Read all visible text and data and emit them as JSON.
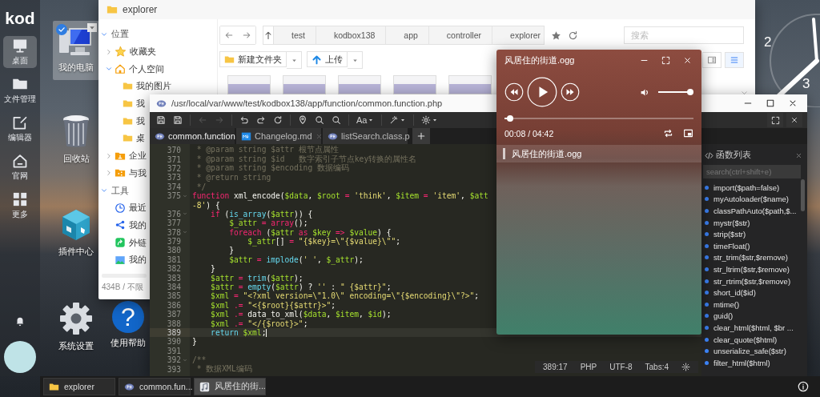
{
  "dock": {
    "logo": "kod",
    "items": [
      {
        "kind": "desktop",
        "label": "桌面",
        "selected": true
      },
      {
        "kind": "files",
        "label": "文件管理",
        "selected": false
      },
      {
        "kind": "editor",
        "label": "编辑器",
        "selected": false
      },
      {
        "kind": "home",
        "label": "官网",
        "selected": false
      },
      {
        "kind": "apps",
        "label": "更多",
        "selected": false
      }
    ]
  },
  "desktop_icons": [
    {
      "kind": "computer",
      "label": "我的电脑",
      "selected": true
    },
    {
      "kind": "trash",
      "label": "回收站",
      "selected": false
    },
    {
      "kind": "plugin",
      "label": "插件中心",
      "selected": false
    },
    {
      "kind": "settings",
      "label": "系统设置",
      "selected": false
    },
    {
      "kind": "help",
      "label": "使用帮助",
      "selected": false,
      "glyph": "?"
    }
  ],
  "clock": {
    "numerals": [
      "2",
      "3"
    ]
  },
  "explorer": {
    "title": "explorer",
    "tree": [
      {
        "kind": "section",
        "label": "位置",
        "expanded": true,
        "children": [
          {
            "kind": "star",
            "label": "收藏夹",
            "expanded": false
          },
          {
            "kind": "home",
            "label": "个人空间",
            "expanded": true,
            "children": [
              {
                "kind": "folder",
                "label": "我的图片"
              },
              {
                "kind": "folder",
                "label": "我"
              },
              {
                "kind": "folder",
                "label": "我"
              },
              {
                "kind": "folder",
                "label": "桌"
              }
            ]
          },
          {
            "kind": "org",
            "label": "企业",
            "expanded": false
          },
          {
            "kind": "share",
            "label": "与我",
            "expanded": false
          }
        ]
      },
      {
        "kind": "section",
        "label": "工具",
        "expanded": true,
        "children": [
          {
            "kind": "recent",
            "label": "最近"
          },
          {
            "kind": "link",
            "label": "我的"
          },
          {
            "kind": "outlink",
            "label": "外链"
          },
          {
            "kind": "photo",
            "label": "我的"
          }
        ]
      }
    ],
    "footer": {
      "usage": "434B / 不限"
    },
    "breadcrumb": [
      "test",
      "kodbox138",
      "app",
      "controller",
      "explorer"
    ],
    "search": {
      "placeholder": "搜索"
    },
    "toolbar": [
      "新建文件夹",
      "上传"
    ]
  },
  "editor": {
    "path": "/usr/local/var/www/test/kodbox138/app/function/common.function.php",
    "font_label": "Aa",
    "tabs": [
      {
        "kind": "php",
        "label": "common.function",
        "selected": true
      },
      {
        "kind": "md",
        "label": "Changelog.md",
        "selected": false
      },
      {
        "kind": "php",
        "label": "listSearch.class.p",
        "selected": false
      }
    ],
    "lines": [
      {
        "num": "370",
        "fold": false,
        "active": false,
        "tokens": [
          {
            "kind": "comment",
            "text": " * @param string $attr 根节点属性"
          }
        ]
      },
      {
        "num": "371",
        "fold": false,
        "active": false,
        "tokens": [
          {
            "kind": "comment",
            "text": " * @param string $id   数字索引子节点key转换的属性名"
          }
        ]
      },
      {
        "num": "372",
        "fold": false,
        "active": false,
        "tokens": [
          {
            "kind": "comment",
            "text": " * @param string $encoding 数据编码"
          }
        ]
      },
      {
        "num": "373",
        "fold": false,
        "active": false,
        "tokens": [
          {
            "kind": "comment",
            "text": " * @return string"
          }
        ]
      },
      {
        "num": "374",
        "fold": false,
        "active": false,
        "tokens": [
          {
            "kind": "comment",
            "text": " */"
          }
        ]
      },
      {
        "num": "375",
        "fold": true,
        "active": false,
        "tokens": [
          {
            "kind": "keyword",
            "text": "function"
          },
          {
            "kind": "plain",
            "text": " xml_encode("
          },
          {
            "kind": "variable",
            "text": "$data"
          },
          {
            "kind": "plain",
            "text": ", "
          },
          {
            "kind": "variable",
            "text": "$root"
          },
          {
            "kind": "keyword",
            "text": " = "
          },
          {
            "kind": "string",
            "text": "'think'"
          },
          {
            "kind": "plain",
            "text": ", "
          },
          {
            "kind": "variable",
            "text": "$item"
          },
          {
            "kind": "keyword",
            "text": " = "
          },
          {
            "kind": "string",
            "text": "'item'"
          },
          {
            "kind": "plain",
            "text": ", "
          },
          {
            "kind": "variable",
            "text": "$att"
          }
        ]
      },
      {
        "fold": false,
        "active": false,
        "tokens": [
          {
            "kind": "string",
            "text": "-8'"
          },
          {
            "kind": "plain",
            "text": ") {"
          }
        ]
      },
      {
        "num": "376",
        "fold": true,
        "active": false,
        "tokens": [
          {
            "kind": "keyword",
            "text": "    if"
          },
          {
            "kind": "plain",
            "text": " ("
          },
          {
            "kind": "function",
            "text": "is_array"
          },
          {
            "kind": "plain",
            "text": "("
          },
          {
            "kind": "variable",
            "text": "$attr"
          },
          {
            "kind": "plain",
            "text": ")) {"
          }
        ]
      },
      {
        "num": "377",
        "fold": false,
        "active": false,
        "tokens": [
          {
            "kind": "variable",
            "text": "        $_attr"
          },
          {
            "kind": "keyword",
            "text": " = "
          },
          {
            "kind": "keyword",
            "text": "array"
          },
          {
            "kind": "plain",
            "text": "();"
          }
        ]
      },
      {
        "num": "378",
        "fold": true,
        "active": false,
        "tokens": [
          {
            "kind": "keyword",
            "text": "        foreach"
          },
          {
            "kind": "plain",
            "text": " ("
          },
          {
            "kind": "variable",
            "text": "$attr"
          },
          {
            "kind": "keyword",
            "text": " as "
          },
          {
            "kind": "variable",
            "text": "$key"
          },
          {
            "kind": "keyword",
            "text": " => "
          },
          {
            "kind": "variable",
            "text": "$value"
          },
          {
            "kind": "plain",
            "text": ") {"
          }
        ]
      },
      {
        "num": "379",
        "fold": false,
        "active": false,
        "tokens": [
          {
            "kind": "variable",
            "text": "            $_attr"
          },
          {
            "kind": "plain",
            "text": "[]"
          },
          {
            "kind": "keyword",
            "text": " = "
          },
          {
            "kind": "string",
            "text": "\"{$key}=\\\"{$value}\\\"\""
          },
          {
            "kind": "plain",
            "text": ";"
          }
        ]
      },
      {
        "num": "380",
        "fold": false,
        "active": false,
        "tokens": [
          {
            "kind": "plain",
            "text": "        }"
          }
        ]
      },
      {
        "num": "381",
        "fold": false,
        "active": false,
        "tokens": [
          {
            "kind": "variable",
            "text": "        $attr"
          },
          {
            "kind": "keyword",
            "text": " = "
          },
          {
            "kind": "function",
            "text": "implode"
          },
          {
            "kind": "plain",
            "text": "("
          },
          {
            "kind": "string",
            "text": "' '"
          },
          {
            "kind": "plain",
            "text": ", "
          },
          {
            "kind": "variable",
            "text": "$_attr"
          },
          {
            "kind": "plain",
            "text": ");"
          }
        ]
      },
      {
        "num": "382",
        "fold": false,
        "active": false,
        "tokens": [
          {
            "kind": "plain",
            "text": "    }"
          }
        ]
      },
      {
        "num": "383",
        "fold": false,
        "active": false,
        "tokens": [
          {
            "kind": "variable",
            "text": "    $attr"
          },
          {
            "kind": "keyword",
            "text": " = "
          },
          {
            "kind": "function",
            "text": "trim"
          },
          {
            "kind": "plain",
            "text": "("
          },
          {
            "kind": "variable",
            "text": "$attr"
          },
          {
            "kind": "plain",
            "text": ");"
          }
        ]
      },
      {
        "num": "384",
        "fold": false,
        "active": false,
        "tokens": [
          {
            "kind": "variable",
            "text": "    $attr"
          },
          {
            "kind": "keyword",
            "text": " = "
          },
          {
            "kind": "function",
            "text": "empty"
          },
          {
            "kind": "plain",
            "text": "("
          },
          {
            "kind": "variable",
            "text": "$attr"
          },
          {
            "kind": "plain",
            "text": ") ? "
          },
          {
            "kind": "string",
            "text": "''"
          },
          {
            "kind": "plain",
            "text": " : "
          },
          {
            "kind": "string",
            "text": "\" {$attr}\""
          },
          {
            "kind": "plain",
            "text": ";"
          }
        ]
      },
      {
        "num": "385",
        "fold": false,
        "active": false,
        "tokens": [
          {
            "kind": "variable",
            "text": "    $xml"
          },
          {
            "kind": "keyword",
            "text": " = "
          },
          {
            "kind": "string",
            "text": "\"<?xml version=\\\"1.0\\\" encoding=\\\"{$encoding}\\\"?>\""
          },
          {
            "kind": "plain",
            "text": ";"
          }
        ]
      },
      {
        "num": "386",
        "fold": false,
        "active": false,
        "tokens": [
          {
            "kind": "variable",
            "text": "    $xml"
          },
          {
            "kind": "keyword",
            "text": " .= "
          },
          {
            "kind": "string",
            "text": "\"<{$root}{$attr}>\""
          },
          {
            "kind": "plain",
            "text": ";"
          }
        ]
      },
      {
        "num": "387",
        "fold": false,
        "active": false,
        "tokens": [
          {
            "kind": "variable",
            "text": "    $xml"
          },
          {
            "kind": "keyword",
            "text": " .= "
          },
          {
            "kind": "plain",
            "text": "data_to_xml("
          },
          {
            "kind": "variable",
            "text": "$data"
          },
          {
            "kind": "plain",
            "text": ", "
          },
          {
            "kind": "variable",
            "text": "$item"
          },
          {
            "kind": "plain",
            "text": ", "
          },
          {
            "kind": "variable",
            "text": "$id"
          },
          {
            "kind": "plain",
            "text": ");"
          }
        ]
      },
      {
        "num": "388",
        "fold": false,
        "active": false,
        "tokens": [
          {
            "kind": "variable",
            "text": "    $xml"
          },
          {
            "kind": "keyword",
            "text": " .= "
          },
          {
            "kind": "string",
            "text": "\"</{$root}>\""
          },
          {
            "kind": "plain",
            "text": ";"
          }
        ]
      },
      {
        "num": "389",
        "fold": false,
        "active": true,
        "tokens": [
          {
            "kind": "function",
            "text": "    return"
          },
          {
            "kind": "variable",
            "text": " $xml"
          },
          {
            "kind": "plain",
            "text": ";"
          }
        ]
      },
      {
        "num": "390",
        "fold": false,
        "active": false,
        "tokens": [
          {
            "kind": "plain",
            "text": "}"
          }
        ]
      },
      {
        "num": "391",
        "fold": false,
        "active": false
      },
      {
        "num": "392",
        "fold": true,
        "active": false,
        "tokens": [
          {
            "kind": "comment",
            "text": "/**"
          }
        ]
      },
      {
        "num": "393",
        "fold": false,
        "active": false,
        "tokens": [
          {
            "kind": "comment",
            "text": " * 数据XML编码"
          }
        ]
      }
    ],
    "status": [
      "389:17",
      "PHP",
      "UTF-8",
      "Tabs:4"
    ],
    "outline": {
      "title": "函数列表",
      "search_placeholder": "search(ctrl+shift+e)",
      "items": [
        "import($path=false)",
        "myAutoloader($name)",
        "classPathAuto($path,$...",
        "mystr($str)",
        "strip($str)",
        "timeFloat()",
        "str_trim($str,$remove)",
        "str_ltrim($str,$remove)",
        "str_rtrim($str,$remove)",
        "short_id($id)",
        "mtime()",
        "guid()",
        "clear_html($html, $br ...",
        "clear_quote($html)",
        "unserialize_safe($str)",
        "filter_html($html)"
      ]
    }
  },
  "player": {
    "title": "风居住的街道.ogg",
    "playing": false,
    "volume": {
      "level": 1.0
    },
    "progress": {
      "level": 0.03
    },
    "time": "00:08 / 04:42",
    "playlist": [
      {
        "label": "风居住的街道.ogg",
        "selected": true
      }
    ]
  },
  "taskbar": {
    "items": [
      {
        "kind": "folder",
        "label": "explorer",
        "selected": false
      },
      {
        "kind": "php",
        "label": "common.fun...",
        "selected": false
      },
      {
        "kind": "music",
        "label": "风居住的街...",
        "selected": true
      }
    ]
  }
}
